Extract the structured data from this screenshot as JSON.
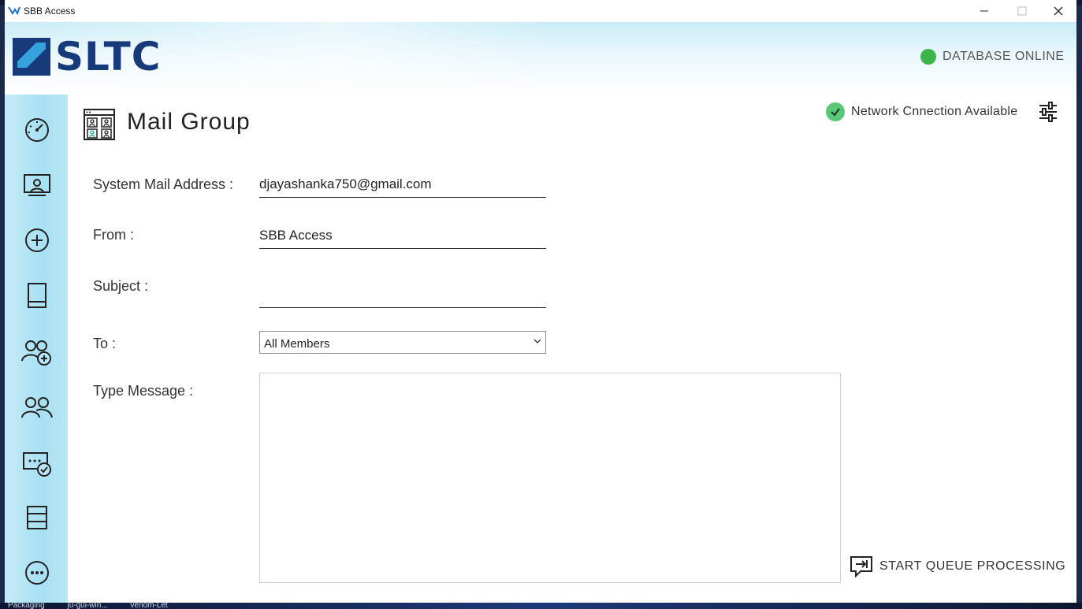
{
  "window": {
    "title": "SBB Access",
    "minimize_icon": "minimize-icon",
    "maximize_icon": "maximize-icon",
    "close_icon": "close-icon"
  },
  "taskbar": {
    "items": [
      "Packaging",
      "ju-gui-win...",
      "venom-Let"
    ]
  },
  "header": {
    "logo_text": "SLTC",
    "db_status": "DATABASE ONLINE",
    "db_status_color": "#3cb44b"
  },
  "sidebar": {
    "items": [
      {
        "icon": "dashboard-gauge-icon"
      },
      {
        "icon": "presentation-user-icon"
      },
      {
        "icon": "add-circle-icon"
      },
      {
        "icon": "book-icon"
      },
      {
        "icon": "add-group-icon"
      },
      {
        "icon": "group-icon"
      },
      {
        "icon": "message-check-icon"
      },
      {
        "icon": "list-rows-icon"
      },
      {
        "icon": "more-circle-icon"
      }
    ]
  },
  "page": {
    "title": "Mail Group",
    "icon": "mail-group-icon",
    "network_status": "Network Cnnection Available",
    "network_color": "#58c878",
    "settings_icon": "sliders-icon"
  },
  "form": {
    "system_mail_label": "System Mail Address :",
    "system_mail_value": "djayashanka750@gmail.com",
    "from_label": "From :",
    "from_value": "SBB Access",
    "subject_label": "Subject :",
    "subject_value": "",
    "to_label": "To :",
    "to_value": "All Members",
    "message_label": "Type Message :",
    "message_value": ""
  },
  "actions": {
    "start_queue_label": "START QUEUE PROCESSING",
    "start_queue_icon": "queue-arrow-icon"
  }
}
